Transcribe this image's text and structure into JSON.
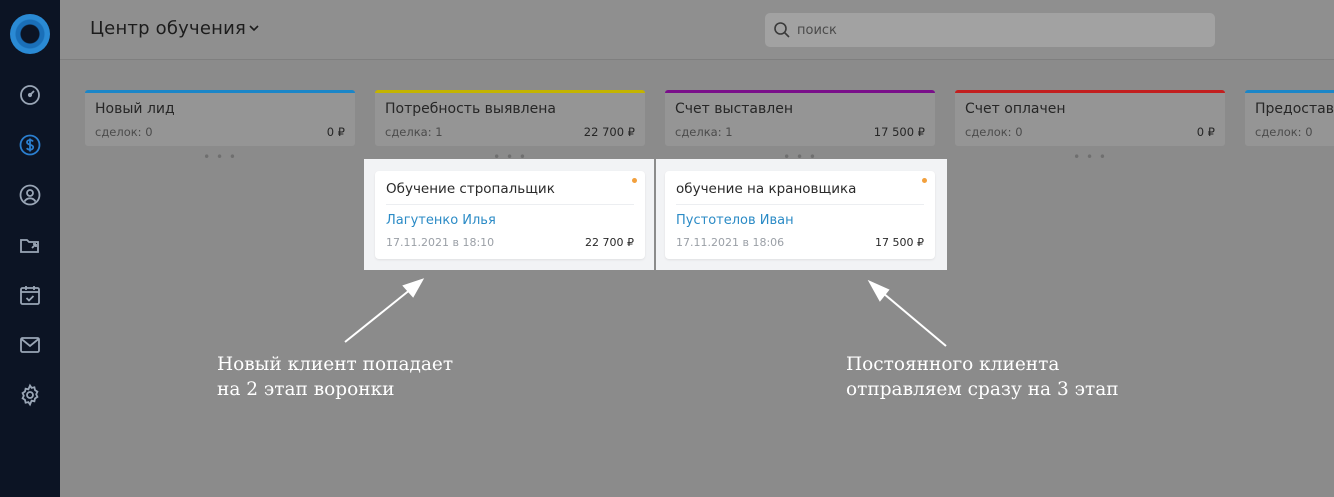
{
  "header": {
    "title": "Центр обучения",
    "search_placeholder": "поиск"
  },
  "sidebar": {
    "icons": [
      "dashboard-icon",
      "dollar-icon",
      "contact-icon",
      "folder-share-icon",
      "calendar-check-icon",
      "mail-icon",
      "gear-icon"
    ],
    "active": "dollar-icon"
  },
  "columns": [
    {
      "name": "Новый лид",
      "count": "сделок: 0",
      "sum": "0 ₽",
      "color": "#1b86c8"
    },
    {
      "name": "Потребность выявлена",
      "count": "сделка: 1",
      "sum": "22 700 ₽",
      "color": "#c4b400"
    },
    {
      "name": "Счет выставлен",
      "count": "сделка: 1",
      "sum": "17 500 ₽",
      "color": "#7a0f8a"
    },
    {
      "name": "Счет оплачен",
      "count": "сделок: 0",
      "sum": "0 ₽",
      "color": "#c21f1f"
    },
    {
      "name": "Предоставл",
      "count": "сделок: 0",
      "sum": "",
      "color": "#1b86c8"
    }
  ],
  "cards": [
    {
      "title": "Обучение стропальщик",
      "person": "Лагутенко Илья",
      "date": "17.11.2021 в 18:10",
      "amount": "22 700 ₽"
    },
    {
      "title": "обучение на крановщика",
      "person": "Пустотелов Иван",
      "date": "17.11.2021 в 18:06",
      "amount": "17 500 ₽"
    }
  ],
  "annotations": {
    "left": [
      "Новый клиент попадает",
      "на 2 этап воронки"
    ],
    "right": [
      "Постоянного клиента",
      "отправляем сразу на 3 этап"
    ]
  },
  "colors": {
    "accent_link": "#2b8bc6",
    "status_dot": "#f2a03d",
    "sidebar_bg": "#0c1424"
  }
}
